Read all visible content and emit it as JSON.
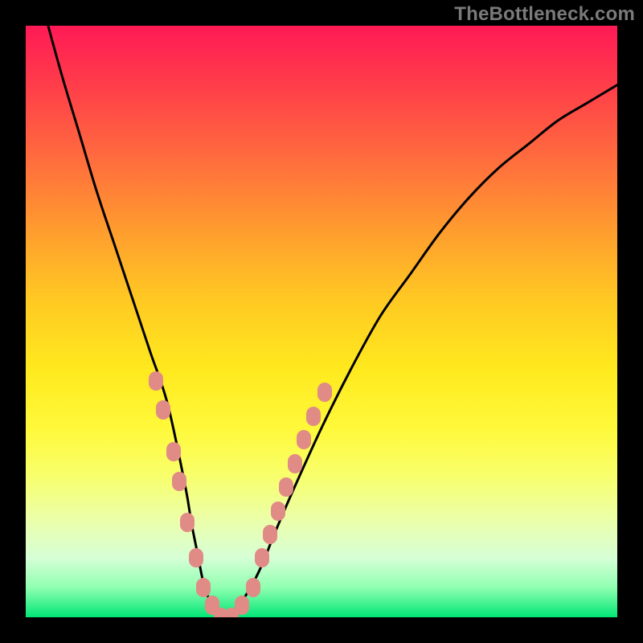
{
  "attribution": "TheBottleneck.com",
  "colors": {
    "frame": "#000000",
    "curve_stroke": "#000000",
    "marker_fill": "#e18b86",
    "gradient_stops": [
      "#ff1a55",
      "#ff3d4a",
      "#ff6a3e",
      "#ff9a2f",
      "#ffc823",
      "#ffe91e",
      "#fff93a",
      "#f8ff6b",
      "#eaffad",
      "#d6ffd6",
      "#8fffb0",
      "#00e676"
    ]
  },
  "chart_data": {
    "type": "line",
    "title": "",
    "xlabel": "",
    "ylabel": "",
    "xlim": [
      0,
      100
    ],
    "ylim": [
      0,
      100
    ],
    "grid": false,
    "legend": false,
    "series": [
      {
        "name": "bottleneck-curve",
        "x": [
          0,
          3,
          6,
          9,
          12,
          15,
          18,
          21,
          24,
          27,
          28,
          29,
          30,
          31,
          32,
          33,
          34,
          35,
          36,
          38,
          40,
          42,
          45,
          50,
          55,
          60,
          65,
          70,
          75,
          80,
          85,
          90,
          95,
          100
        ],
        "y": [
          115,
          103,
          92,
          82,
          72,
          63,
          54,
          45,
          36,
          22,
          16,
          11,
          6,
          3,
          1,
          0,
          0,
          1,
          2,
          5,
          9,
          14,
          21,
          32,
          42,
          51,
          58,
          65,
          71,
          76,
          80,
          84,
          87,
          90
        ]
      }
    ],
    "markers": [
      {
        "x": 22.0,
        "y": 40
      },
      {
        "x": 23.2,
        "y": 35
      },
      {
        "x": 25.0,
        "y": 28
      },
      {
        "x": 26.0,
        "y": 23
      },
      {
        "x": 27.3,
        "y": 16
      },
      {
        "x": 28.8,
        "y": 10
      },
      {
        "x": 30.0,
        "y": 5
      },
      {
        "x": 31.5,
        "y": 2
      },
      {
        "x": 33.0,
        "y": 0
      },
      {
        "x": 34.8,
        "y": 0
      },
      {
        "x": 36.5,
        "y": 2
      },
      {
        "x": 38.5,
        "y": 5
      },
      {
        "x": 40.0,
        "y": 10
      },
      {
        "x": 41.3,
        "y": 14
      },
      {
        "x": 42.7,
        "y": 18
      },
      {
        "x": 44.0,
        "y": 22
      },
      {
        "x": 45.5,
        "y": 26
      },
      {
        "x": 47.0,
        "y": 30
      },
      {
        "x": 48.7,
        "y": 34
      },
      {
        "x": 50.5,
        "y": 38
      }
    ]
  }
}
